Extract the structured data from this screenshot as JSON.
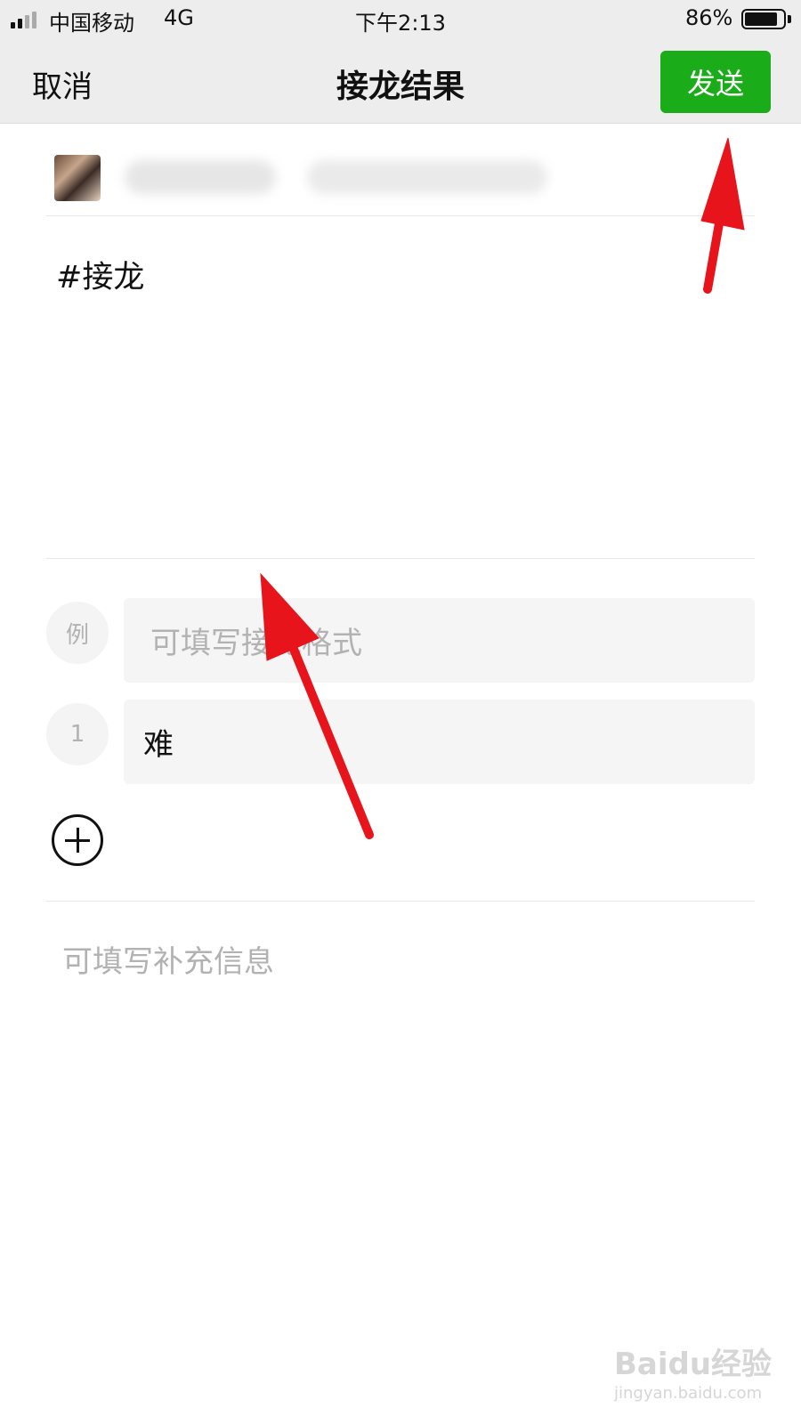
{
  "status_bar": {
    "carrier": "中国移动",
    "network": "4G",
    "time": "下午2:13",
    "battery_percent": "86%",
    "battery_level": 0.86
  },
  "nav": {
    "cancel_label": "取消",
    "title": "接龙结果",
    "send_label": "发送",
    "send_color": "#1aad19"
  },
  "post": {
    "topic": "#接龙"
  },
  "entries": {
    "example_badge": "例",
    "example_placeholder": "可填写接龙格式",
    "items": [
      {
        "index": "1",
        "value": "难"
      }
    ]
  },
  "extra_info_placeholder": "可填写补充信息",
  "watermark": {
    "brand": "Baidu经验",
    "url": "jingyan.baidu.com"
  },
  "annotations": {
    "arrow_color": "#e8141b"
  }
}
